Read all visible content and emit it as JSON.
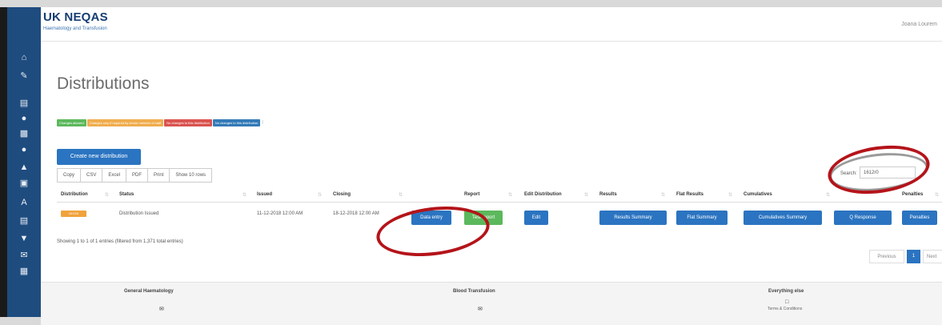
{
  "app": {
    "brand_name": "UK NEQAS",
    "brand_sub": "Haematology and Transfusion",
    "user_name": "Joana Lourem"
  },
  "sidebar": {
    "icons": [
      "home-icon",
      "edit-icon",
      "list-icon",
      "users-icon",
      "bar-chart-icon",
      "globe-icon",
      "flask-icon",
      "file-icon",
      "font-icon",
      "table-icon",
      "map-marker-icon",
      "envelope-icon",
      "calendar-icon"
    ]
  },
  "page": {
    "title": "Distributions",
    "legend": [
      {
        "label": "Changes allowed",
        "color": "#5cb85c"
      },
      {
        "label": "Changes only if required by senior member of staff",
        "color": "#f0ad4e"
      },
      {
        "label": "No changes to this distribution",
        "color": "#d9534f"
      },
      {
        "label": "No changes to this distribution",
        "color": "#337ab7"
      }
    ],
    "legend_trail": "|",
    "create_button": "Create new distribution",
    "export_buttons": [
      "Copy",
      "CSV",
      "Excel",
      "PDF",
      "Print",
      "Show 10 rows"
    ],
    "search_label": "Search:",
    "search_value": "1612r0"
  },
  "table": {
    "headers": [
      "Distribution",
      "Status",
      "Issued",
      "Closing",
      "Report",
      "Edit Distribution",
      "Results",
      "Flat Results",
      "Cumulatives",
      "Penalties"
    ],
    "row": {
      "badge": "1612r0",
      "status": "Distribution Issued",
      "issued": "11-12-2018 12:00 AM",
      "closing": "18-12-2018 12:00 AM",
      "data_entry": "Data entry",
      "report": "Test report",
      "edit": "Edit",
      "results_summary": "Results Summary",
      "flat_summary": "Flat Summary",
      "cumulatives_summary": "Cumulatives Summary",
      "q_response": "Q Response",
      "penalties": "Penalties"
    },
    "info": "Showing 1 to 1 of 1 entries (filtered from 1,371 total entries)"
  },
  "pagination": {
    "previous": "Previous",
    "current": "1",
    "next": "Next"
  },
  "footer": {
    "col1_title": "General Haematology",
    "col2_title": "Blood Transfusion",
    "col3_title": "Everything else",
    "col3_link": "Terms & Conditions"
  },
  "colors": {
    "sidebar": "#1f4c7f",
    "primary": "#2b74c1",
    "annotation": "#b4141a"
  }
}
